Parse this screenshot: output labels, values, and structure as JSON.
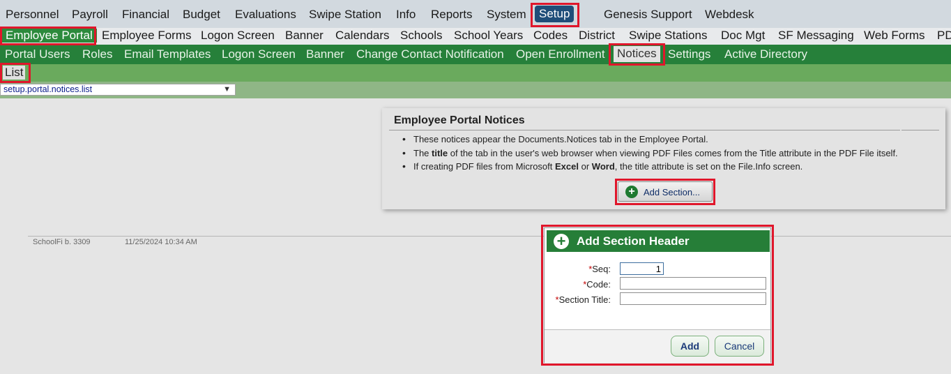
{
  "top_menu": [
    "Personnel",
    "Payroll",
    "Financial",
    "Budget",
    "Evaluations",
    "Swipe Station",
    "Info",
    "Reports",
    "System",
    "Setup",
    "Genesis Support",
    "Webdesk"
  ],
  "setup_menu": [
    "Employee Portal",
    "Employee Forms",
    "Logon Screen",
    "Banner",
    "Calendars",
    "Schools",
    "School Years",
    "Codes",
    "District",
    "Swipe Stations",
    "Doc Mgt",
    "SF Messaging",
    "Web Forms",
    "PD"
  ],
  "portal_menu": [
    "Portal Users",
    "Roles",
    "Email Templates",
    "Logon Screen",
    "Banner",
    "Change Contact Notification",
    "Open Enrollment",
    "Notices",
    "Settings",
    "Active Directory"
  ],
  "notices_menu": [
    "List"
  ],
  "selector": {
    "value": "setup.portal.notices.list"
  },
  "panel": {
    "title": "Employee Portal Notices",
    "bullet1": "These notices appear the Documents.Notices tab in the Employee Portal.",
    "bullet2_a": "The ",
    "bullet2_b": "title",
    "bullet2_c": " of the tab in the user's web browser when viewing PDF Files comes from the Title attribute in the PDF File itself.",
    "bullet3_a": "If creating PDF files from Microsoft ",
    "bullet3_b": "Excel",
    "bullet3_c": " or ",
    "bullet3_d": "Word",
    "bullet3_e": ", the title attribute is set on the File.Info screen.",
    "add_button": "Add Section..."
  },
  "footer": {
    "build": "SchoolFi b. 3309",
    "timestamp": "11/25/2024 10:34 AM"
  },
  "dialog": {
    "title": "Add Section Header",
    "required_mark": "*",
    "seq_label": "Seq:",
    "seq_value": "1",
    "code_label": "Code:",
    "code_value": "",
    "section_title_label": "Section Title:",
    "section_title_value": "",
    "add_button": "Add",
    "cancel_button": "Cancel"
  },
  "colors": {
    "highlight": "#e0162b",
    "brand_green": "#26803a",
    "active_blue": "#1f4e79"
  },
  "icons": [
    "plus-circle-icon",
    "chevron-down-icon"
  ]
}
